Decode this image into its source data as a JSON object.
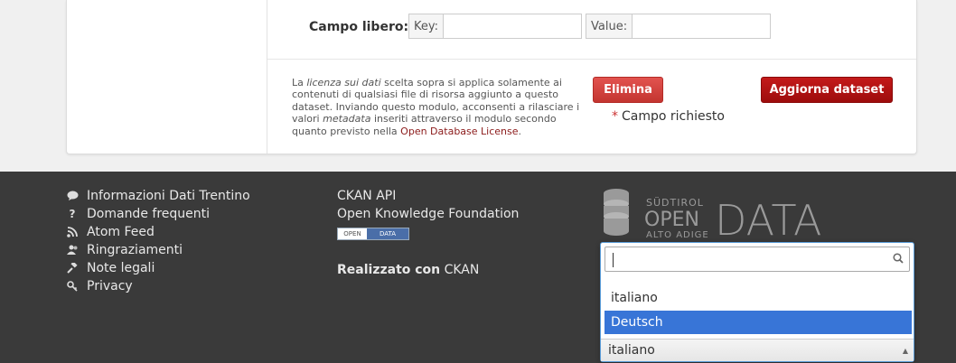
{
  "form": {
    "campo_label": "Campo libero:",
    "key_label": "Key:",
    "key_value": "",
    "value_label": "Value:",
    "value_value": "",
    "terms_before": "La ",
    "terms_em1": "licenza sui dati",
    "terms_mid1": " scelta sopra si applica solamente ai contenuti di qualsiasi file di risorsa aggiunto a questo dataset. Inviando questo modulo, acconsenti a rilasciare i valori ",
    "terms_em2": "metadata",
    "terms_mid2": " inseriti attraverso il modulo secondo quanto previsto nella ",
    "terms_link": "Open Database License",
    "terms_end": ".",
    "delete_label": "Elimina",
    "update_label": "Aggiorna dataset",
    "required_star": "*",
    "required_label": "Campo richiesto"
  },
  "footer": {
    "links": [
      {
        "icon": "comment-icon",
        "label": "Informazioni Dati Trentino"
      },
      {
        "icon": "question-icon",
        "label": "Domande frequenti"
      },
      {
        "icon": "rss-icon",
        "label": "Atom Feed"
      },
      {
        "icon": "users-icon",
        "label": "Ringraziamenti"
      },
      {
        "icon": "gavel-icon",
        "label": "Note legali"
      },
      {
        "icon": "key-icon",
        "label": "Privacy"
      }
    ],
    "col2": [
      "CKAN API",
      "Open Knowledge Foundation"
    ],
    "badge_left": "OPEN",
    "badge_right": "DATA",
    "made_with_bold": "Realizzato con",
    "made_with_link": "CKAN",
    "logo": {
      "top": "SÜDTIROL",
      "open": "OPEN",
      "bottom": "ALTO ADIGE",
      "data": "DATA"
    }
  },
  "language_dropdown": {
    "search_placeholder": "",
    "options": [
      "italiano",
      "Deutsch"
    ],
    "highlighted": "Deutsch",
    "selected": "italiano"
  }
}
